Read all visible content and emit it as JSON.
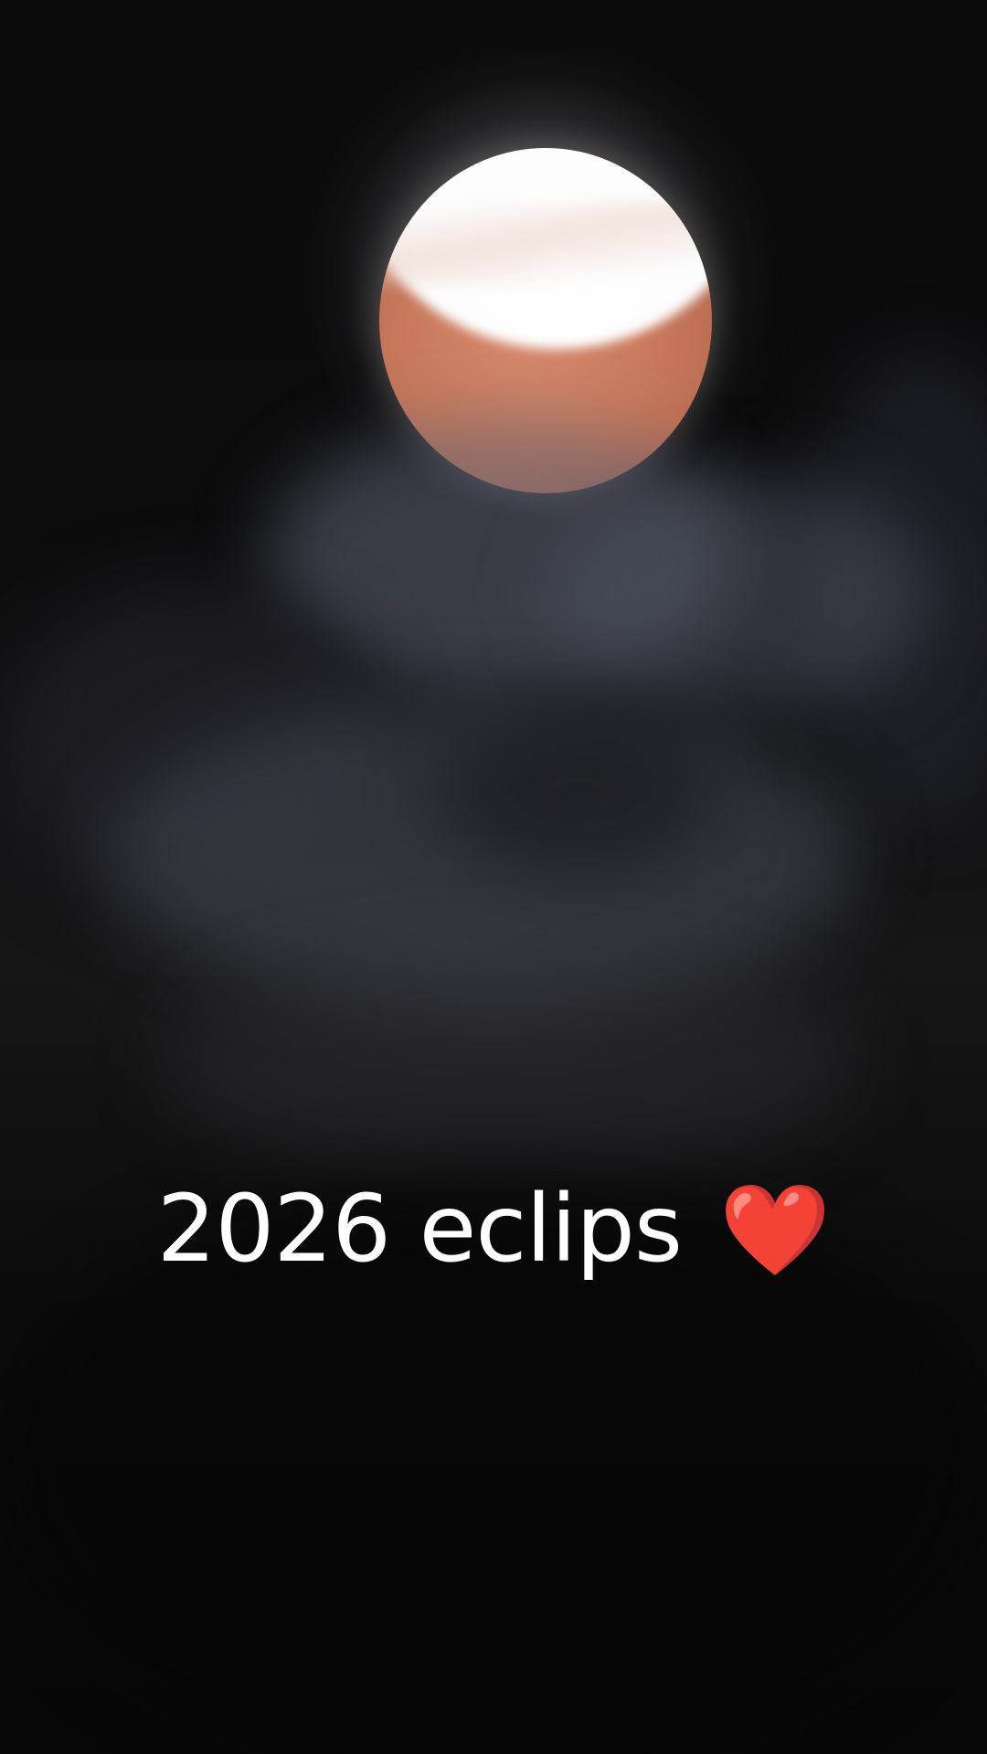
{
  "photo": {
    "subject": "lunar-eclipse-moon-behind-clouds",
    "colors": {
      "moon_shadow": "#c97a5c",
      "moon_lit": "#ffffff",
      "clouds": "#5f6476",
      "sky": "#0a0a0a"
    }
  },
  "caption": {
    "text": "2026 eclips",
    "emoji": "❤️"
  }
}
